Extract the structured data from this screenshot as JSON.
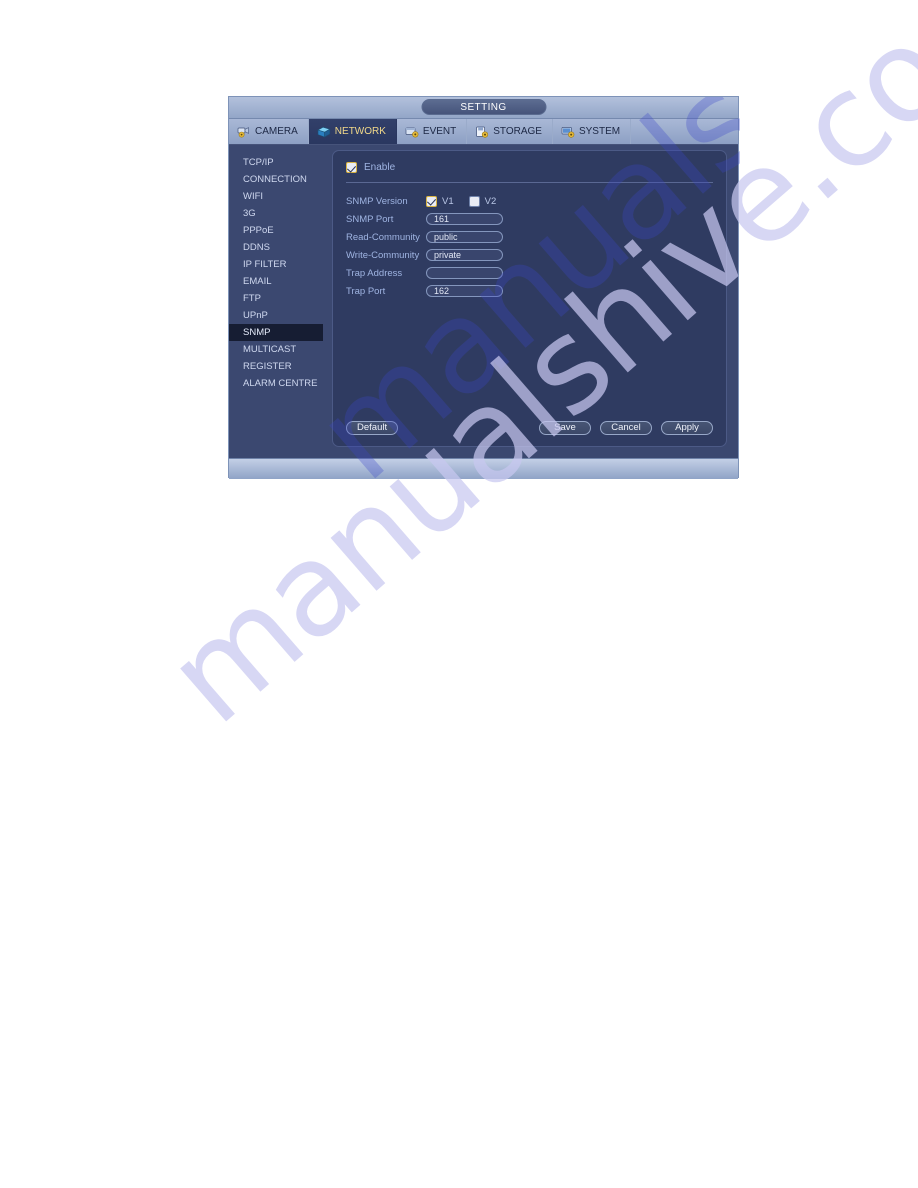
{
  "watermark": {
    "text": "manualshive.com"
  },
  "window": {
    "title": "SETTING",
    "tabs": [
      {
        "label": "CAMERA",
        "icon": "camera-icon",
        "active": false
      },
      {
        "label": "NETWORK",
        "icon": "network-icon",
        "active": true
      },
      {
        "label": "EVENT",
        "icon": "event-icon",
        "active": false
      },
      {
        "label": "STORAGE",
        "icon": "storage-icon",
        "active": false
      },
      {
        "label": "SYSTEM",
        "icon": "system-icon",
        "active": false
      }
    ],
    "sidebar": {
      "items": [
        {
          "label": "TCP/IP",
          "active": false
        },
        {
          "label": "CONNECTION",
          "active": false
        },
        {
          "label": "WIFI",
          "active": false
        },
        {
          "label": "3G",
          "active": false
        },
        {
          "label": "PPPoE",
          "active": false
        },
        {
          "label": "DDNS",
          "active": false
        },
        {
          "label": "IP FILTER",
          "active": false
        },
        {
          "label": "EMAIL",
          "active": false
        },
        {
          "label": "FTP",
          "active": false
        },
        {
          "label": "UPnP",
          "active": false
        },
        {
          "label": "SNMP",
          "active": true
        },
        {
          "label": "MULTICAST",
          "active": false
        },
        {
          "label": "REGISTER",
          "active": false
        },
        {
          "label": "ALARM CENTRE",
          "active": false
        }
      ]
    },
    "form": {
      "enable_label": "Enable",
      "enable_checked": true,
      "version_label": "SNMP Version",
      "v1_label": "V1",
      "v1_checked": true,
      "v2_label": "V2",
      "v2_checked": false,
      "fields": [
        {
          "label": "SNMP Port",
          "value": "161"
        },
        {
          "label": "Read-Community",
          "value": "public"
        },
        {
          "label": "Write-Community",
          "value": "private"
        },
        {
          "label": "Trap Address",
          "value": ""
        },
        {
          "label": "Trap Port",
          "value": "162"
        }
      ]
    },
    "buttons": {
      "default": "Default",
      "save": "Save",
      "cancel": "Cancel",
      "apply": "Apply"
    },
    "colors": {
      "panel_bg": "#2f3b61",
      "active_tab_text": "#f2d98a",
      "label_text": "#9fb4e2",
      "checkbox_on_border": "#d9b443"
    }
  }
}
